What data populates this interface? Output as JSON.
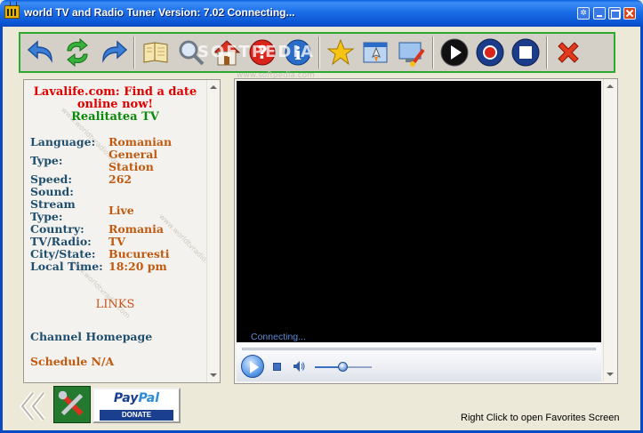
{
  "window": {
    "title": "world TV and Radio Tuner Version: 7.02 Connecting..."
  },
  "toolbar": {
    "buttons": [
      {
        "name": "back-button",
        "icon": "undo-arrow-icon"
      },
      {
        "name": "refresh-button",
        "icon": "refresh-arrows-icon"
      },
      {
        "name": "forward-button",
        "icon": "redo-arrow-icon"
      },
      {
        "name": "guide-button",
        "icon": "book-icon"
      },
      {
        "name": "search-button",
        "icon": "magnifier-icon"
      },
      {
        "name": "home-button",
        "icon": "house-icon"
      },
      {
        "name": "help-button",
        "icon": "question-icon"
      },
      {
        "name": "info-button",
        "icon": "info-icon"
      },
      {
        "name": "favorites-button",
        "icon": "star-icon"
      },
      {
        "name": "launch-button",
        "icon": "rocket-window-icon"
      },
      {
        "name": "skin-button",
        "icon": "monitor-brush-icon"
      },
      {
        "name": "play-button",
        "icon": "play-icon"
      },
      {
        "name": "record-button",
        "icon": "record-icon"
      },
      {
        "name": "stop-button",
        "icon": "stop-icon"
      },
      {
        "name": "exit-button",
        "icon": "close-x-icon"
      }
    ]
  },
  "watermark": {
    "brand": "SOFTPEDIA",
    "url": "www.softpedia.com"
  },
  "info": {
    "ad": [
      "Lavalife.com: Find a date",
      "online now!"
    ],
    "channel": "Realitatea TV",
    "fields": [
      {
        "label": "Language:",
        "value": "Romanian"
      },
      {
        "label": "Type:",
        "value": "General Station"
      },
      {
        "label": "Speed:",
        "value": "262"
      },
      {
        "label": "Sound:",
        "value": ""
      },
      {
        "label": "Stream Type:",
        "value": "Live"
      },
      {
        "label": "Country:",
        "value": "Romania"
      },
      {
        "label": "TV/Radio:",
        "value": "TV"
      },
      {
        "label": "City/State:",
        "value": "Bucuresti"
      },
      {
        "label": "Local Time:",
        "value": "18:20 pm"
      }
    ],
    "links_heading": "LINKS",
    "homepage_link": "Channel Homepage",
    "schedule_link": "Schedule N/A",
    "side_watermark": "www.worldtvradio.com"
  },
  "player": {
    "status": "Connecting...",
    "volume": 0.5
  },
  "bottom": {
    "paypal_brand_a": "Pay",
    "paypal_brand_b": "Pal",
    "paypal_donate": "DONATE",
    "favorites_hint": "Right Click to open Favorites Screen"
  },
  "colors": {
    "title_bar": "#0b56d4",
    "toolbar_border": "#2fa832",
    "ad_text": "#e00000",
    "channel_text": "#0a8a0a",
    "label_text": "#1f4e6e",
    "value_text": "#c05a10"
  }
}
